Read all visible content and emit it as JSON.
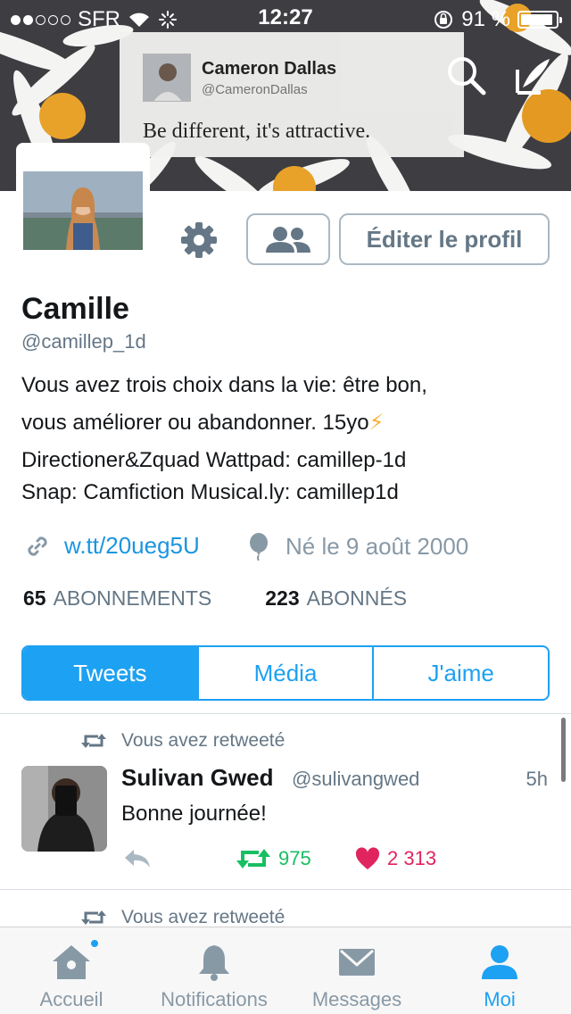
{
  "status_bar": {
    "carrier": "SFR",
    "time": "12:27",
    "battery_percent": "91 %",
    "battery_level": 0.91
  },
  "header": {
    "pinned_card": {
      "name": "Cameron Dallas",
      "handle": "@CameronDallas",
      "text": "Be different, it's attractive."
    },
    "icons": [
      "search-icon",
      "compose-icon"
    ]
  },
  "profile": {
    "name": "Camille",
    "handle": "@camillep_1d",
    "bio_lines": [
      "Vous avez trois choix dans la vie: être bon,",
      "vous améliorer ou abandonner. 15yo",
      "Directioner&Zquad Wattpad: camillep-1d",
      "Snap: Camfiction Musical.ly: camillep1d"
    ],
    "bio_emoji": "⚡",
    "link": "w.tt/20ueg5U",
    "birthdate": "Né le 9 août 2000",
    "following_count": "65",
    "following_label": "ABONNEMENTS",
    "followers_count": "223",
    "followers_label": "ABONNÉS",
    "edit_button": "Éditer le profil"
  },
  "segments": {
    "items": [
      "Tweets",
      "Média",
      "J'aime"
    ],
    "active": "Tweets"
  },
  "tweet": {
    "context": "Vous avez retweeté",
    "author": "Sulivan Gwed",
    "handle": "@sulivangwed",
    "time": "5h",
    "text": "Bonne journée!",
    "retweets": "975",
    "likes": "2 313"
  },
  "next_tweet_context": "Vous avez retweeté",
  "tabbar": {
    "items": [
      "Accueil",
      "Notifications",
      "Messages",
      "Moi"
    ],
    "active": "Moi"
  },
  "colors": {
    "accent": "#1da1f2",
    "retweet": "#17bf63",
    "like": "#e0245e",
    "muted": "#657786"
  }
}
